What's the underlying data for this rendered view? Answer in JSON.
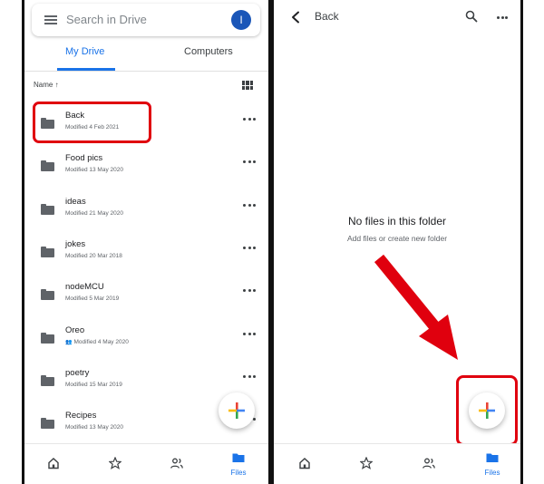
{
  "left_screen": {
    "search": {
      "placeholder": "Search in Drive",
      "avatar_letter": "I"
    },
    "tabs": [
      {
        "label": "My Drive",
        "selected": true
      },
      {
        "label": "Computers",
        "selected": false
      }
    ],
    "sort": {
      "label": "Name",
      "direction": "ascending"
    },
    "view_toggle_icon": "grid-view-icon",
    "files": [
      {
        "name": "Back",
        "meta": "Modified 4 Feb 2021",
        "shared": false,
        "highlighted": true
      },
      {
        "name": "Food pics",
        "meta": "Modified 13 May 2020",
        "shared": false
      },
      {
        "name": "ideas",
        "meta": "Modified 21 May 2020",
        "shared": false
      },
      {
        "name": "jokes",
        "meta": "Modified 20 Mar 2018",
        "shared": false
      },
      {
        "name": "nodeMCU",
        "meta": "Modified 5 Mar 2019",
        "shared": false
      },
      {
        "name": "Oreo",
        "meta": "Modified 4 May 2020",
        "shared": true
      },
      {
        "name": "poetry",
        "meta": "Modified 15 Mar 2019",
        "shared": false
      },
      {
        "name": "Recipes",
        "meta": "Modified 13 May 2020",
        "shared": false
      }
    ],
    "bottom_nav": [
      {
        "icon": "home-icon",
        "label": ""
      },
      {
        "icon": "star-icon",
        "label": ""
      },
      {
        "icon": "shared-people-icon",
        "label": ""
      },
      {
        "icon": "folder-icon",
        "label": "Files",
        "active": true
      }
    ]
  },
  "right_screen": {
    "header": {
      "back_label": "Back"
    },
    "empty_state": {
      "title": "No files in this folder",
      "subtitle": "Add files or create new folder"
    },
    "bottom_nav": [
      {
        "icon": "home-icon",
        "label": ""
      },
      {
        "icon": "star-icon",
        "label": ""
      },
      {
        "icon": "shared-people-icon",
        "label": ""
      },
      {
        "icon": "folder-icon",
        "label": "Files",
        "active": true
      }
    ]
  },
  "colors": {
    "accent_blue": "#1a73e8",
    "highlight_red": "#e0000e",
    "avatar_blue": "#1a56b8",
    "plus_blue": "#4285f4",
    "plus_red": "#ea4335",
    "plus_yellow": "#fbbc04",
    "plus_green": "#34a853"
  }
}
